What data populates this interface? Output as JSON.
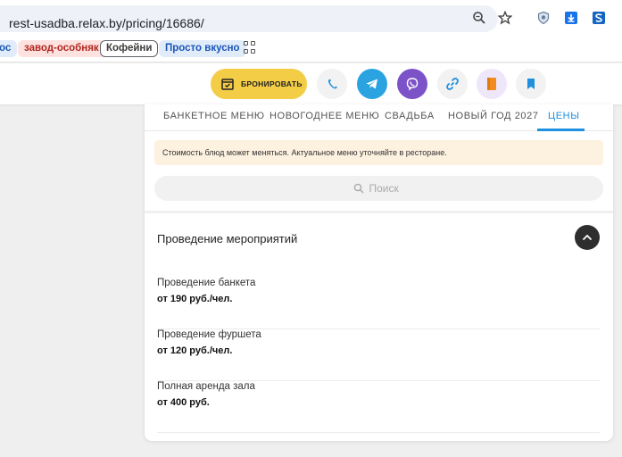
{
  "browser": {
    "url": "rest-usadba.relax.by/pricing/16686/",
    "icons": [
      "zoom-icon",
      "bookmark-star-icon",
      "shield-extension-icon",
      "download-icon",
      "sync-extension-icon"
    ]
  },
  "bookmarks": [
    {
      "label": "ос"
    },
    {
      "label": "завод-особняк"
    },
    {
      "label": "Кофейни"
    },
    {
      "label": "Просто вкусно"
    }
  ],
  "header": {
    "book_label": "БРОНИРОВАТЬ",
    "contact_icons": [
      "phone-icon",
      "telegram-icon",
      "viber-icon",
      "link-icon",
      "menu-book-icon",
      "bookmark-icon"
    ],
    "colors": {
      "book": "#f4cd46",
      "telegram": "#2aa3e0",
      "viber": "#7c52c9"
    }
  },
  "tabs": [
    {
      "label": "БАНКЕТНОЕ МЕНЮ"
    },
    {
      "label": "НОВОГОДНЕЕ МЕНЮ"
    },
    {
      "label": "СВАДЬБА"
    },
    {
      "label": "НОВЫЙ ГОД 2027"
    },
    {
      "label": "ЦЕНЫ",
      "active": true
    }
  ],
  "notice": "Стоимость блюд может меняться. Актуальное меню уточняйте в ресторане.",
  "search": {
    "placeholder": "Поиск"
  },
  "section": {
    "title": "Проведение мероприятий",
    "items": [
      {
        "name": "Проведение банкета",
        "price": "от 190 руб./чел."
      },
      {
        "name": "Проведение фуршета",
        "price": "от 120 руб./чел."
      },
      {
        "name": "Полная аренда зала",
        "price": "от 400 руб."
      }
    ]
  },
  "accent_color": "#1f8fe0"
}
